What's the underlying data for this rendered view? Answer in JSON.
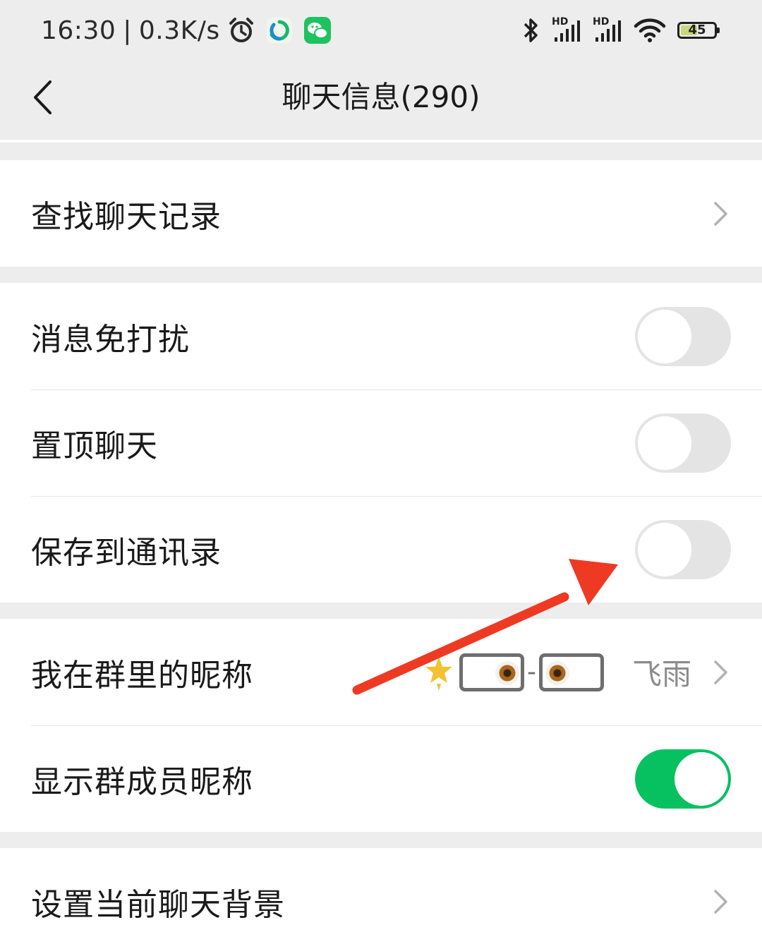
{
  "status_bar": {
    "time": "16:30",
    "separator": "|",
    "net_speed": "0.3K/s",
    "hd1": "HD",
    "hd2": "HD",
    "battery": "45",
    "icons": [
      "alarm-icon",
      "app-icon",
      "wechat-icon",
      "bluetooth-icon",
      "signal-icon",
      "signal-icon",
      "wifi-icon",
      "battery-icon"
    ]
  },
  "nav": {
    "title": "聊天信息(290)",
    "back_icon": "chevron-left-icon"
  },
  "settings": {
    "search_history": {
      "label": "查找聊天记录"
    },
    "mute": {
      "label": "消息免打扰",
      "on": false
    },
    "pin_chat": {
      "label": "置顶聊天",
      "on": false
    },
    "save_to_contacts": {
      "label": "保存到通讯录",
      "on": false
    },
    "group_nickname": {
      "label": "我在群里的昵称",
      "value_text": "飞雨",
      "dash": "-"
    },
    "show_member_nicknames": {
      "label": "显示群成员昵称",
      "on": true
    },
    "chat_background": {
      "label": "设置当前聊天背景"
    }
  },
  "colors": {
    "background": "#ededed",
    "toggle_on": "#07c160",
    "toggle_off": "#e4e4e4",
    "annotation": "#ee3a22"
  }
}
